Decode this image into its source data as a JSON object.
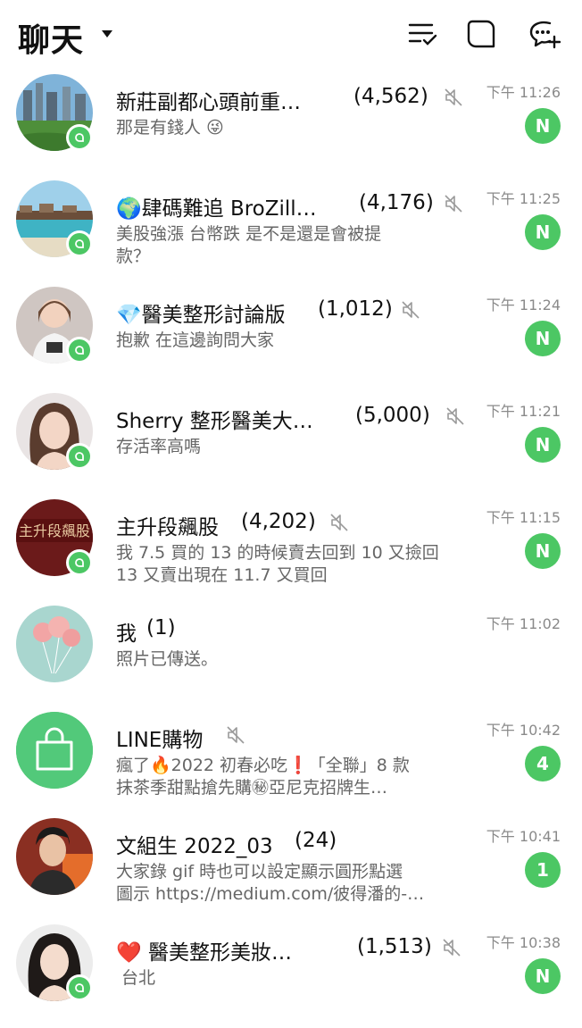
{
  "header": {
    "title": "聊天",
    "icons": [
      "sort-checklist-icon",
      "new-chat-bubble-icon",
      "add-chat-icon"
    ]
  },
  "chats": [
    {
      "name": "新莊副都心頭前重…",
      "count": "(4,562)",
      "muted": true,
      "message_line1": "那是有錢人 😜",
      "message_line2": "",
      "time": "下午 11:26",
      "unread": "N"
    },
    {
      "name": "🌍肆碼難追 BroZill…",
      "count": "(4,176)",
      "muted": true,
      "message_line1": "美股強漲 台幣跌 是不是還是會被提",
      "message_line2": "款？",
      "time": "下午 11:25",
      "unread": "N"
    },
    {
      "name": "💎醫美整形討論版",
      "count": "(1,012)",
      "muted": true,
      "message_line1": "抱歉 在這邊詢問大家",
      "message_line2": "",
      "time": "下午 11:24",
      "unread": "N"
    },
    {
      "name": "Sherry 整形醫美大…",
      "count": "(5,000)",
      "muted": true,
      "message_line1": "存活率高嗎",
      "message_line2": "",
      "time": "下午 11:21",
      "unread": "N"
    },
    {
      "name": "主升段飆股",
      "count": "(4,202)",
      "muted": true,
      "message_line1": "我 7.5 買的 13 的時候賣去回到 10 又撿回",
      "message_line2": "13 又賣出現在 11.7 又買回",
      "time": "下午 11:15",
      "unread": "N"
    },
    {
      "name": "我",
      "count": "(1)",
      "muted": false,
      "message_line1": "照片已傳送。",
      "message_line2": "",
      "time": "下午 11:02",
      "unread": ""
    },
    {
      "name": "LINE購物",
      "count": "",
      "muted": true,
      "message_line1": "瘋了🔥2022 初春必吃❗「全聯」8 款",
      "message_line2": "抹茶季甜點搶先購㊙亞尼克招牌生…",
      "time": "下午 10:42",
      "unread": "4"
    },
    {
      "name": "文組生 2022_03",
      "count": "(24)",
      "muted": false,
      "message_line1": "大家錄 gif 時也可以設定顯示圓形點選",
      "message_line2": "圖示 https://medium.com/彼得潘的-…",
      "time": "下午 10:41",
      "unread": "1"
    },
    {
      "name": "❤️ 醫美整形美妝…",
      "count": "(1,513)",
      "muted": true,
      "message_line1": "台北",
      "message_line2": "",
      "time": "下午 10:38",
      "unread": "N"
    }
  ],
  "colors": {
    "accent": "#4cc764",
    "time": "#8a8a8a",
    "message": "#666666"
  }
}
